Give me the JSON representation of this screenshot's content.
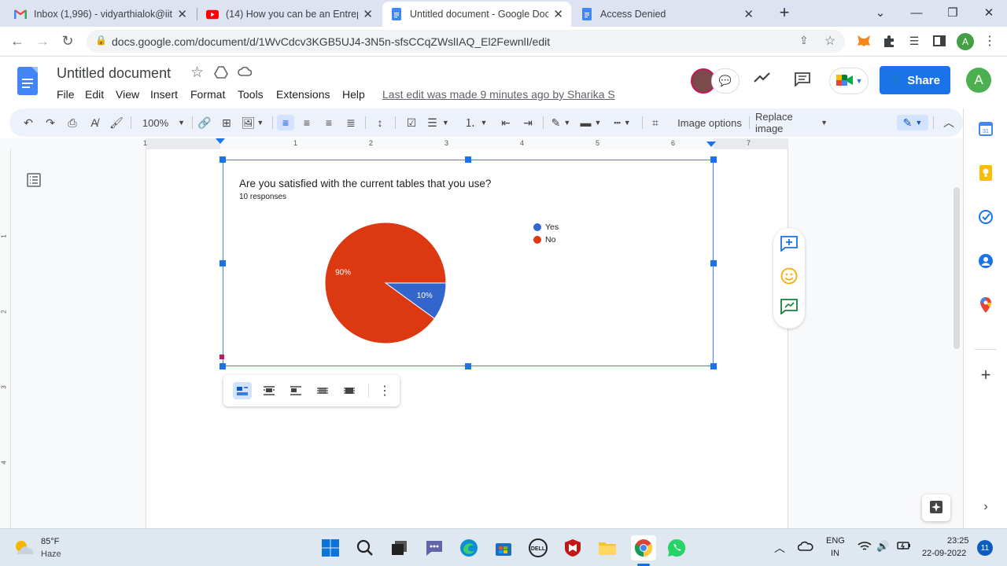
{
  "tabs": [
    {
      "title": "Inbox (1,996) - vidyarthialok@iitg",
      "icon": "gmail-icon"
    },
    {
      "title": "(14) How you can be an Entrepre",
      "icon": "youtube-icon"
    },
    {
      "title": "Untitled document - Google Doc",
      "icon": "docs-icon"
    },
    {
      "title": "Access Denied",
      "icon": "docs-icon"
    }
  ],
  "window": {
    "new_tab": "+",
    "chevron": "⌄",
    "minimize": "—",
    "restore": "❐",
    "close": "✕"
  },
  "addressbar": {
    "url": "docs.google.com/document/d/1WvCdcv3KGB5UJ4-3N5n-sfsCCqZWslIAQ_El2FewnlI/edit"
  },
  "doc": {
    "title": "Untitled document",
    "menu": [
      "File",
      "Edit",
      "View",
      "Insert",
      "Format",
      "Tools",
      "Extensions",
      "Help"
    ],
    "last_edit": "Last edit was made 9 minutes ago by Sharika S",
    "share": "Share",
    "avatar": "A"
  },
  "toolbar": {
    "zoom": "100%",
    "image_options": "Image options",
    "replace_image": "Replace image"
  },
  "ruler": {
    "h_numbers": [
      "1",
      "1",
      "2",
      "3",
      "4",
      "5",
      "6",
      "7"
    ],
    "v_numbers": [
      "1",
      "2",
      "3",
      "4"
    ]
  },
  "chart_data": {
    "type": "pie",
    "title": "Are you satisfied with the current tables that you use?",
    "subtitle": "10 responses",
    "categories": [
      "Yes",
      "No"
    ],
    "values": [
      10,
      90
    ],
    "labels": [
      "10%",
      "90%"
    ],
    "colors": [
      "#3366cc",
      "#dc3912"
    ],
    "legend_position": "right"
  },
  "taskbar": {
    "weather_temp": "85°F",
    "weather_desc": "Haze",
    "lang": "ENG",
    "region": "IN",
    "time": "23:25",
    "date": "22-09-2022",
    "notifications": "11"
  },
  "colors": {
    "accent": "#1a73e8",
    "docs_blue": "#4285f4",
    "tab_strip": "#dee3f1",
    "toolbar_bg": "#edf2fa"
  }
}
